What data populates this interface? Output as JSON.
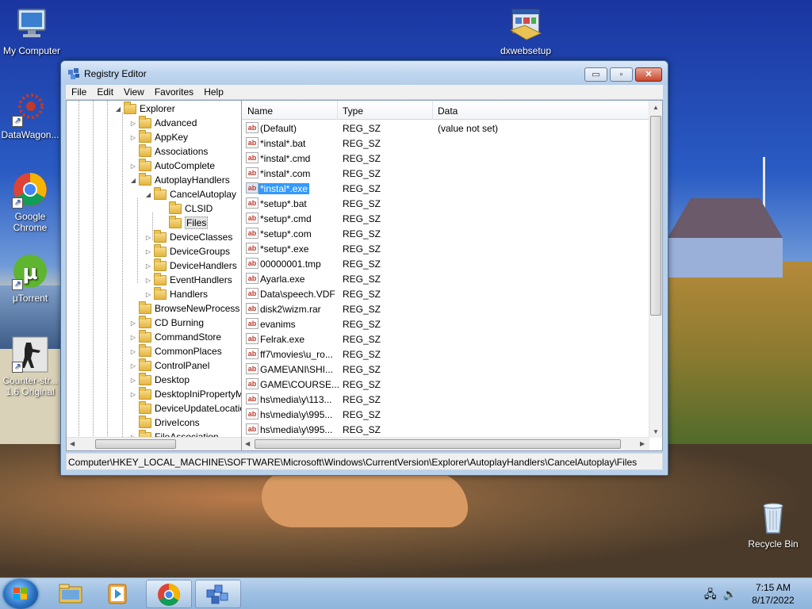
{
  "desktop": {
    "icons": [
      {
        "label": "My Computer"
      },
      {
        "label": "DataWagon..."
      },
      {
        "label": "Google Chrome"
      },
      {
        "label": "µTorrent"
      },
      {
        "label": "Counter-str... 1.6 Original"
      },
      {
        "label": "dxwebsetup"
      },
      {
        "label": "Recycle Bin"
      }
    ]
  },
  "window": {
    "title": "Registry Editor",
    "buttons": {
      "minimize": "▭",
      "maximize": "▫",
      "close": "✕"
    },
    "menu": [
      "File",
      "Edit",
      "View",
      "Favorites",
      "Help"
    ],
    "tree": [
      {
        "label": "Explorer",
        "expander": "◢"
      },
      {
        "label": "Advanced",
        "expander": "▷"
      },
      {
        "label": "AppKey",
        "expander": "▷"
      },
      {
        "label": "Associations",
        "expander": ""
      },
      {
        "label": "AutoComplete",
        "expander": "▷"
      },
      {
        "label": "AutoplayHandlers",
        "expander": "◢"
      },
      {
        "label": "CancelAutoplay",
        "expander": "◢"
      },
      {
        "label": "CLSID",
        "expander": ""
      },
      {
        "label": "Files",
        "expander": ""
      },
      {
        "label": "DeviceClasses",
        "expander": "▷"
      },
      {
        "label": "DeviceGroups",
        "expander": "▷"
      },
      {
        "label": "DeviceHandlers",
        "expander": "▷"
      },
      {
        "label": "EventHandlers",
        "expander": "▷"
      },
      {
        "label": "Handlers",
        "expander": "▷"
      },
      {
        "label": "BrowseNewProcess",
        "expander": ""
      },
      {
        "label": "CD Burning",
        "expander": "▷"
      },
      {
        "label": "CommandStore",
        "expander": "▷"
      },
      {
        "label": "CommonPlaces",
        "expander": "▷"
      },
      {
        "label": "ControlPanel",
        "expander": "▷"
      },
      {
        "label": "Desktop",
        "expander": "▷"
      },
      {
        "label": "DesktopIniPropertyMap",
        "expander": "▷"
      },
      {
        "label": "DeviceUpdateLocations",
        "expander": ""
      },
      {
        "label": "DriveIcons",
        "expander": ""
      },
      {
        "label": "FileAssociation",
        "expander": "▷"
      }
    ],
    "list": {
      "columns": {
        "name": "Name",
        "type": "Type",
        "data": "Data"
      },
      "rows": [
        {
          "name": "(Default)",
          "type": "REG_SZ",
          "data": "(value not set)"
        },
        {
          "name": "*instal*.bat",
          "type": "REG_SZ",
          "data": ""
        },
        {
          "name": "*instal*.cmd",
          "type": "REG_SZ",
          "data": ""
        },
        {
          "name": "*instal*.com",
          "type": "REG_SZ",
          "data": ""
        },
        {
          "name": "*instal*.exe",
          "type": "REG_SZ",
          "data": ""
        },
        {
          "name": "*setup*.bat",
          "type": "REG_SZ",
          "data": ""
        },
        {
          "name": "*setup*.cmd",
          "type": "REG_SZ",
          "data": ""
        },
        {
          "name": "*setup*.com",
          "type": "REG_SZ",
          "data": ""
        },
        {
          "name": "*setup*.exe",
          "type": "REG_SZ",
          "data": ""
        },
        {
          "name": "00000001.tmp",
          "type": "REG_SZ",
          "data": ""
        },
        {
          "name": "Ayarla.exe",
          "type": "REG_SZ",
          "data": ""
        },
        {
          "name": "Data\\speech.VDF",
          "type": "REG_SZ",
          "data": ""
        },
        {
          "name": "disk2\\wizm.rar",
          "type": "REG_SZ",
          "data": ""
        },
        {
          "name": "evanims",
          "type": "REG_SZ",
          "data": ""
        },
        {
          "name": "Felrak.exe",
          "type": "REG_SZ",
          "data": ""
        },
        {
          "name": "ff7\\movies\\u_ro...",
          "type": "REG_SZ",
          "data": ""
        },
        {
          "name": "GAME\\ANI\\SHI...",
          "type": "REG_SZ",
          "data": ""
        },
        {
          "name": "GAME\\COURSE...",
          "type": "REG_SZ",
          "data": ""
        },
        {
          "name": "hs\\media\\y\\113...",
          "type": "REG_SZ",
          "data": ""
        },
        {
          "name": "hs\\media\\y\\995...",
          "type": "REG_SZ",
          "data": ""
        },
        {
          "name": "hs\\media\\y\\995...",
          "type": "REG_SZ",
          "data": ""
        }
      ]
    },
    "status_path": "Computer\\HKEY_LOCAL_MACHINE\\SOFTWARE\\Microsoft\\Windows\\CurrentVersion\\Explorer\\AutoplayHandlers\\CancelAutoplay\\Files"
  },
  "taskbar": {
    "time": "7:15 AM",
    "date": "8/17/2022"
  }
}
